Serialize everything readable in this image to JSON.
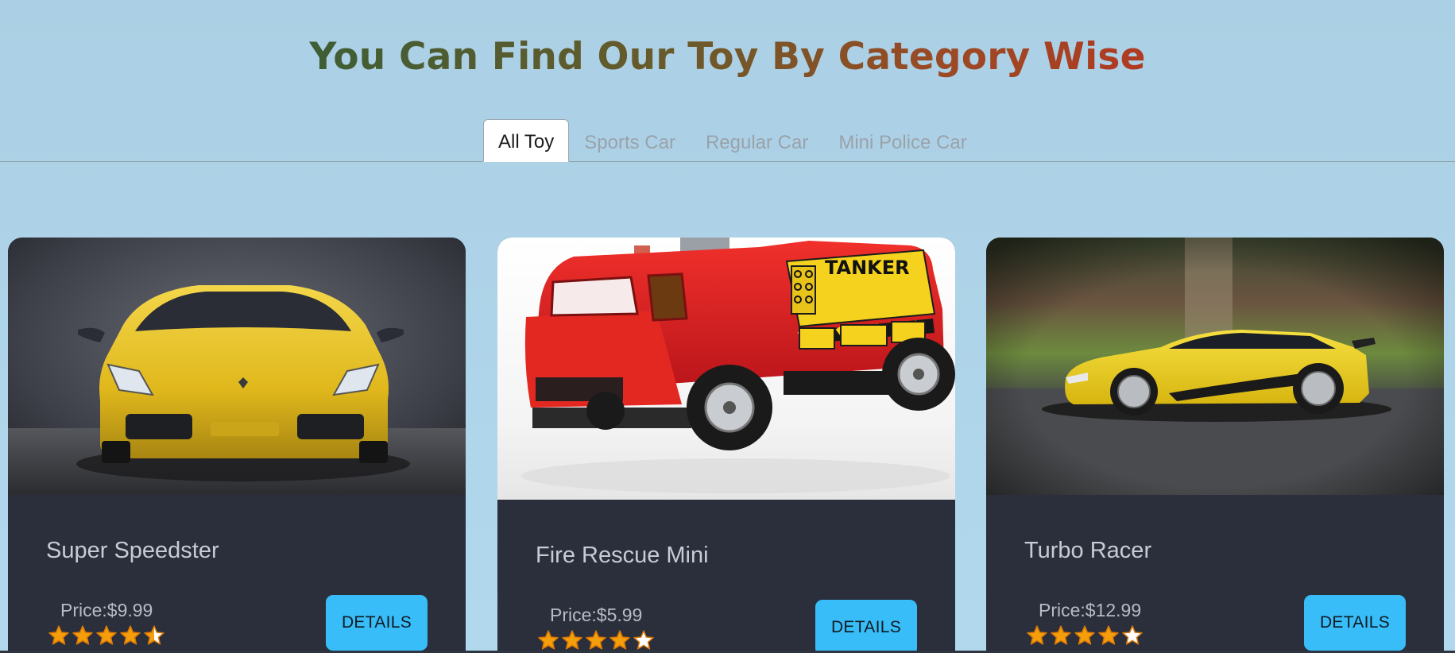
{
  "heading": "You Can Find Our Toy By Category Wise",
  "tabs": [
    "All Toy",
    "Sports Car",
    "Regular Car",
    "Mini Police Car"
  ],
  "active_tab": "All Toy",
  "cards": [
    {
      "name": "Super Speedster",
      "price": "Price:$9.99",
      "rating": 4.5,
      "button": "DETAILS",
      "image": "yellow-sports-car-front"
    },
    {
      "name": "Fire Rescue Mini",
      "price": "Price:$5.99",
      "rating": 4,
      "button": "DETAILS",
      "image": "red-fire-truck-toy",
      "image_text": "TANKER"
    },
    {
      "name": "Turbo Racer",
      "price": "Price:$12.99",
      "rating": 4,
      "button": "DETAILS",
      "image": "yellow-sports-car-side"
    }
  ],
  "colors": {
    "page_background": "#abcfe4",
    "card_background": "#2a2f3b",
    "button": "#38bdf8",
    "star_fill": "#f59e0b"
  }
}
